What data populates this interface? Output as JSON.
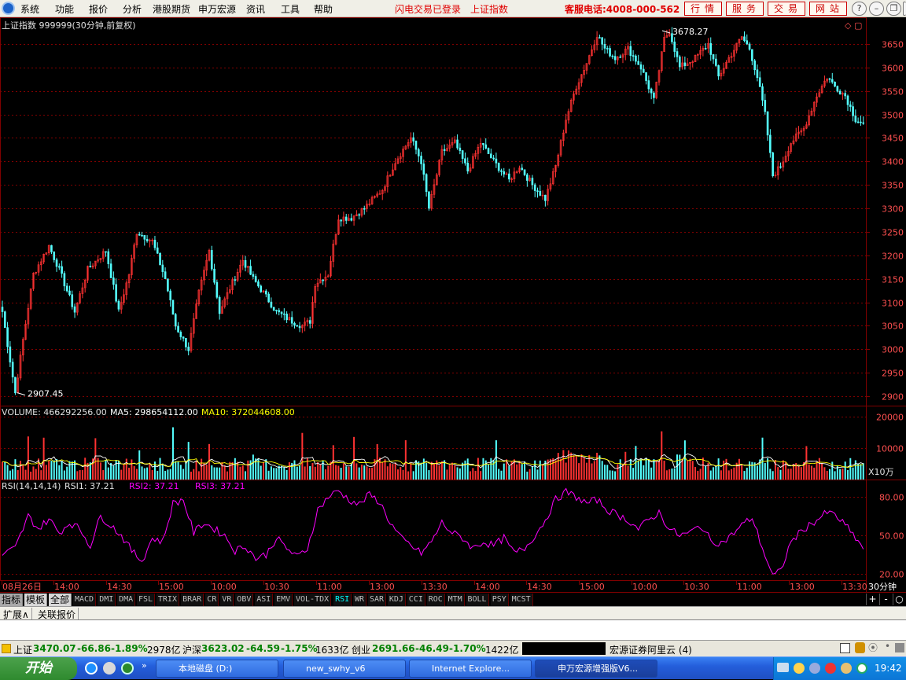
{
  "menu": {
    "items": [
      "系统",
      "功能",
      "报价",
      "分析",
      "港股期货",
      "申万宏源",
      "资讯",
      "工具",
      "帮助"
    ],
    "flash_login": "闪电交易已登录",
    "index_link": "上证指数",
    "hotline": "客服电话:4008-000-562",
    "buttons": [
      "行情",
      "服务",
      "交易",
      "网站"
    ]
  },
  "chart_header": {
    "title": "上证指数 999999(30分钟,前复权)",
    "high_marker": "3678.27",
    "low_marker": "2907.45"
  },
  "volume_header": {
    "volume_label": "VOLUME: 466292256.00",
    "ma5_label": "MA5: 298654112.00",
    "ma10_label": "MA10: 372044608.00",
    "unit": "X10万"
  },
  "rsi_header": {
    "params": "RSI(14,14,14)",
    "rsi1": "RSI1: 37.21",
    "rsi2": "RSI2: 37.21",
    "rsi3": "RSI3: 37.21"
  },
  "colors": {
    "up": "#ff3232",
    "down": "#54ffff",
    "grid": "#800000",
    "ma5": "#ffffff",
    "ma10": "#ffff00",
    "rsi": "#ff00ff"
  },
  "time_axis": [
    "08月26日",
    "14:00",
    "14:30",
    "15:00",
    "10:00",
    "10:30",
    "11:00",
    "13:00",
    "13:30",
    "14:00",
    "14:30",
    "15:00",
    "10:00",
    "10:30",
    "11:00",
    "13:00",
    "13:30"
  ],
  "period_label": "30分钟",
  "indicator_tabs": {
    "left": [
      "指标",
      "模板",
      "全部"
    ],
    "items": [
      "MACD",
      "DMI",
      "DMA",
      "FSL",
      "TRIX",
      "BRAR",
      "CR",
      "VR",
      "OBV",
      "ASI",
      "EMV",
      "VOL-TDX",
      "RSI",
      "WR",
      "SAR",
      "KDJ",
      "CCI",
      "ROC",
      "MTM",
      "BOLL",
      "PSY",
      "MCST"
    ],
    "active": "RSI",
    "controls": [
      "+",
      "-",
      "○"
    ]
  },
  "ext_bar": {
    "items": [
      "扩展∧",
      "关联报价"
    ]
  },
  "status_bar": {
    "sh_label": "上证",
    "sh_value": "3470.07",
    "sh_change": "-66.86",
    "sh_pct": "-1.89%",
    "sh_amount": "2978亿",
    "hs_label": "沪深",
    "hs_value": "3623.02",
    "hs_change": "-64.59",
    "hs_pct": "-1.75%",
    "hs_amount": "1633亿",
    "cy_label": "创业",
    "cy_value": "2691.66",
    "cy_change": "-46.49",
    "cy_pct": "-1.70%",
    "cy_amount": "1422亿",
    "server": "宏源证券阿里云 (4)"
  },
  "taskbar": {
    "start": "开始",
    "tasks": [
      "本地磁盘 (D:)",
      "new_swhy_v6",
      "Internet Explore...",
      "申万宏源增强版V6..."
    ],
    "clock": "19:42"
  },
  "chart_data": [
    {
      "type": "candlestick",
      "title": "上证指数 999999(30分钟,前复权)",
      "ylim": [
        2880,
        3690
      ],
      "y_ticks": [
        2900,
        2950,
        3000,
        3050,
        3100,
        3150,
        3200,
        3250,
        3300,
        3350,
        3400,
        3450,
        3500,
        3550,
        3600,
        3650
      ],
      "annotations": [
        {
          "label": "3678.27",
          "value": 3678.27
        },
        {
          "label": "2907.45",
          "value": 2907.45
        }
      ],
      "anchors": [
        [
          0,
          3080
        ],
        [
          5,
          2907
        ],
        [
          8,
          3020
        ],
        [
          12,
          3160
        ],
        [
          18,
          3220
        ],
        [
          22,
          3170
        ],
        [
          28,
          3080
        ],
        [
          33,
          3170
        ],
        [
          40,
          3210
        ],
        [
          45,
          3080
        ],
        [
          49,
          3160
        ],
        [
          52,
          3250
        ],
        [
          58,
          3230
        ],
        [
          63,
          3150
        ],
        [
          67,
          3050
        ],
        [
          72,
          3000
        ],
        [
          76,
          3120
        ],
        [
          80,
          3210
        ],
        [
          84,
          3080
        ],
        [
          88,
          3130
        ],
        [
          93,
          3190
        ],
        [
          97,
          3150
        ],
        [
          101,
          3120
        ],
        [
          106,
          3080
        ],
        [
          112,
          3060
        ],
        [
          116,
          3050
        ],
        [
          119,
          3060
        ],
        [
          121,
          3140
        ],
        [
          126,
          3160
        ],
        [
          130,
          3280
        ],
        [
          135,
          3280
        ],
        [
          140,
          3300
        ],
        [
          147,
          3340
        ],
        [
          152,
          3400
        ],
        [
          158,
          3450
        ],
        [
          162,
          3400
        ],
        [
          165,
          3300
        ],
        [
          170,
          3420
        ],
        [
          175,
          3440
        ],
        [
          180,
          3380
        ],
        [
          185,
          3440
        ],
        [
          190,
          3400
        ],
        [
          196,
          3360
        ],
        [
          200,
          3390
        ],
        [
          205,
          3350
        ],
        [
          210,
          3320
        ],
        [
          214,
          3390
        ],
        [
          218,
          3490
        ],
        [
          222,
          3560
        ],
        [
          226,
          3610
        ],
        [
          230,
          3670
        ],
        [
          233,
          3640
        ],
        [
          237,
          3620
        ],
        [
          242,
          3640
        ],
        [
          247,
          3600
        ],
        [
          252,
          3530
        ],
        [
          256,
          3660
        ],
        [
          258,
          3678
        ],
        [
          262,
          3600
        ],
        [
          268,
          3620
        ],
        [
          273,
          3650
        ],
        [
          277,
          3580
        ],
        [
          281,
          3620
        ],
        [
          286,
          3665
        ],
        [
          289,
          3640
        ],
        [
          292,
          3580
        ],
        [
          295,
          3500
        ],
        [
          298,
          3370
        ],
        [
          301,
          3390
        ],
        [
          305,
          3440
        ],
        [
          310,
          3470
        ],
        [
          315,
          3540
        ],
        [
          319,
          3580
        ],
        [
          322,
          3560
        ],
        [
          326,
          3540
        ],
        [
          330,
          3490
        ],
        [
          333,
          3480
        ]
      ]
    },
    {
      "type": "bar",
      "title": "VOLUME",
      "ylim": [
        0,
        22000
      ],
      "y_ticks": [
        10000,
        20000
      ],
      "unit": "X10万",
      "series": [
        {
          "name": "VOLUME"
        },
        {
          "name": "MA5"
        },
        {
          "name": "MA10"
        }
      ]
    },
    {
      "type": "line",
      "title": "RSI(14,14,14)",
      "ylim": [
        15,
        90
      ],
      "y_ticks": [
        20,
        50,
        80
      ],
      "series": [
        {
          "name": "RSI1",
          "last": 37.21
        }
      ],
      "anchors": [
        [
          0,
          35
        ],
        [
          5,
          40
        ],
        [
          10,
          65
        ],
        [
          14,
          55
        ],
        [
          18,
          63
        ],
        [
          22,
          52
        ],
        [
          26,
          60
        ],
        [
          30,
          55
        ],
        [
          34,
          42
        ],
        [
          38,
          65
        ],
        [
          42,
          58
        ],
        [
          46,
          50
        ],
        [
          50,
          38
        ],
        [
          54,
          30
        ],
        [
          58,
          48
        ],
        [
          62,
          45
        ],
        [
          66,
          75
        ],
        [
          70,
          78
        ],
        [
          74,
          52
        ],
        [
          78,
          60
        ],
        [
          82,
          55
        ],
        [
          86,
          50
        ],
        [
          90,
          38
        ],
        [
          94,
          42
        ],
        [
          98,
          32
        ],
        [
          102,
          35
        ],
        [
          106,
          48
        ],
        [
          110,
          40
        ],
        [
          114,
          33
        ],
        [
          118,
          40
        ],
        [
          122,
          70
        ],
        [
          126,
          80
        ],
        [
          130,
          85
        ],
        [
          134,
          78
        ],
        [
          138,
          74
        ],
        [
          142,
          82
        ],
        [
          146,
          76
        ],
        [
          150,
          60
        ],
        [
          154,
          48
        ],
        [
          158,
          42
        ],
        [
          162,
          36
        ],
        [
          166,
          45
        ],
        [
          170,
          60
        ],
        [
          174,
          52
        ],
        [
          178,
          48
        ],
        [
          182,
          40
        ],
        [
          186,
          45
        ],
        [
          190,
          42
        ],
        [
          194,
          48
        ],
        [
          198,
          36
        ],
        [
          202,
          40
        ],
        [
          206,
          50
        ],
        [
          210,
          62
        ],
        [
          214,
          78
        ],
        [
          218,
          84
        ],
        [
          222,
          80
        ],
        [
          226,
          75
        ],
        [
          230,
          78
        ],
        [
          234,
          70
        ],
        [
          238,
          66
        ],
        [
          242,
          62
        ],
        [
          246,
          55
        ],
        [
          250,
          62
        ],
        [
          254,
          68
        ],
        [
          258,
          55
        ],
        [
          262,
          50
        ],
        [
          266,
          52
        ],
        [
          270,
          58
        ],
        [
          274,
          46
        ],
        [
          278,
          44
        ],
        [
          282,
          50
        ],
        [
          286,
          58
        ],
        [
          290,
          64
        ],
        [
          294,
          40
        ],
        [
          298,
          18
        ],
        [
          301,
          22
        ],
        [
          305,
          45
        ],
        [
          310,
          55
        ],
        [
          315,
          62
        ],
        [
          319,
          68
        ],
        [
          322,
          66
        ],
        [
          326,
          58
        ],
        [
          330,
          48
        ],
        [
          333,
          40
        ]
      ]
    }
  ]
}
